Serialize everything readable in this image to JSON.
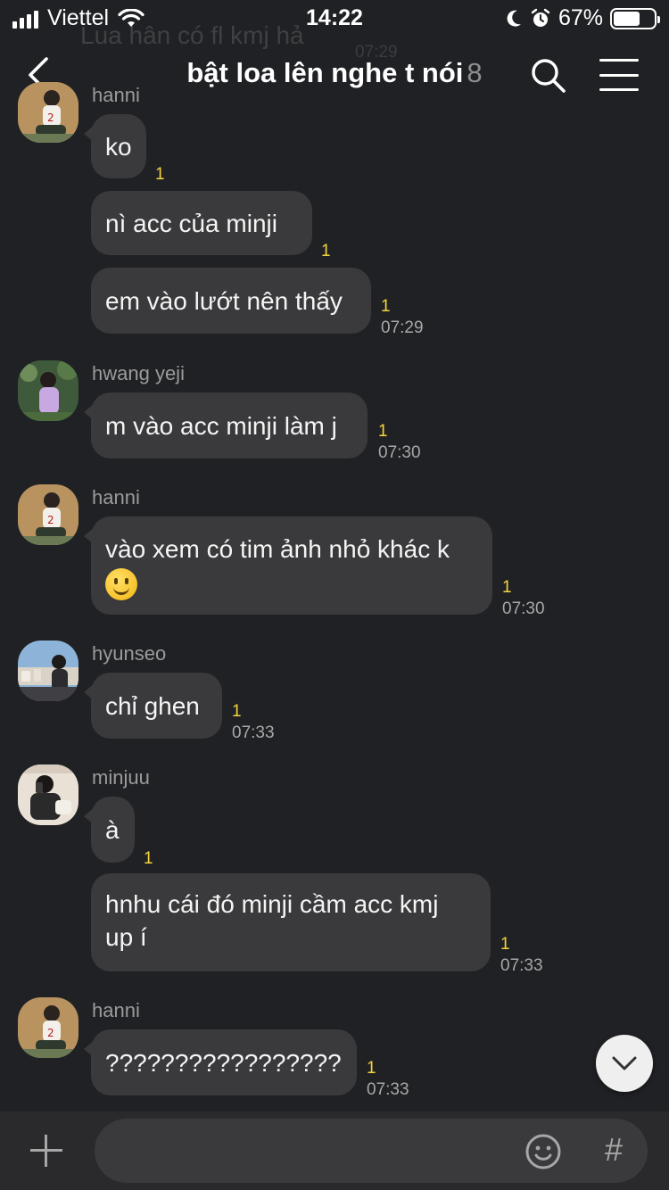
{
  "status_bar": {
    "carrier": "Viettel",
    "time": "14:22",
    "battery": "67%",
    "battery_level": 0.67
  },
  "header": {
    "ghost_text": "Lua hân có fl kmj hả",
    "ghost_time": "07:29",
    "title": "bật loa lên nghe t nói",
    "member_count": "8"
  },
  "messages": [
    {
      "sender": "hanni",
      "bubbles": [
        {
          "text": "ko",
          "unread": "1",
          "time": ""
        },
        {
          "text": "nì acc của minji",
          "unread": "1",
          "time": ""
        },
        {
          "text": "em vào lướt nên thấy",
          "unread": "1",
          "time": "07:29"
        }
      ]
    },
    {
      "sender": "hwang yeji",
      "bubbles": [
        {
          "text": "m vào acc minji làm j",
          "unread": "1",
          "time": "07:30"
        }
      ]
    },
    {
      "sender": "hanni",
      "bubbles": [
        {
          "text": "vào xem có tim ảnh nhỏ khác k",
          "emoji": "slightly-smiling-face",
          "unread": "1",
          "time": "07:30"
        }
      ]
    },
    {
      "sender": "hyunseo",
      "bubbles": [
        {
          "text": "chỉ ghen",
          "unread": "1",
          "time": "07:33"
        }
      ]
    },
    {
      "sender": "minjuu",
      "bubbles": [
        {
          "text": "à",
          "unread": "1",
          "time": ""
        },
        {
          "text": "hnhu cái đó minji cầm acc kmj",
          "text2": "up í",
          "unread": "1",
          "time": "07:33"
        }
      ]
    },
    {
      "sender": "hanni",
      "bubbles": [
        {
          "text": "?????????????????",
          "unread": "1",
          "time": "07:33"
        }
      ]
    }
  ],
  "input": {
    "placeholder": "",
    "hash_label": "#"
  },
  "icons": {
    "back": "chevron-left-icon",
    "search": "search-icon",
    "menu": "hamburger-menu-icon",
    "scroll": "chevron-down-icon",
    "plus": "plus-icon",
    "emoji": "emoji-icon"
  },
  "colors": {
    "background": "#202124",
    "bubble": "#3a3a3c",
    "unread": "#f5d53d",
    "time": "#a8a8a8"
  }
}
